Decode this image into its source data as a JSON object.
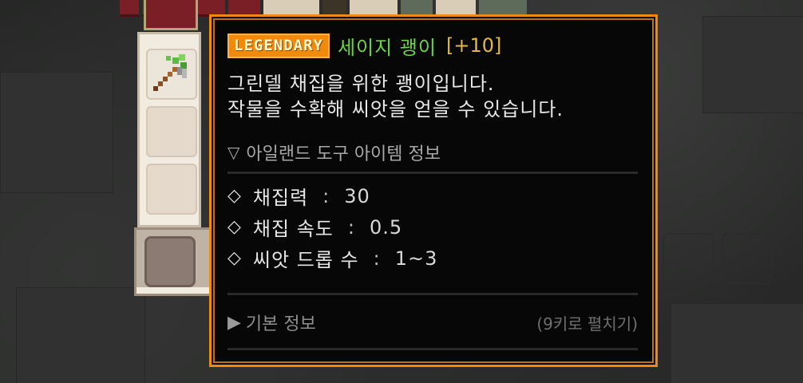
{
  "item": {
    "rarity": "LEGENDARY",
    "name": "세이지 괭이",
    "level": "[+10]",
    "description_lines": [
      "그린델 채집을 위한 괭이입니다.",
      "작물을 수확해 씨앗을 얻을 수 있습니다."
    ]
  },
  "tool_info": {
    "icon": "triangle-down-icon",
    "header": "아일랜드 도구 아이템 정보",
    "stats": [
      {
        "label": "채집력",
        "value": "30"
      },
      {
        "label": "채집 속도",
        "value": "0.5"
      },
      {
        "label": "씨앗 드롭 수",
        "value": "1~3"
      }
    ],
    "separator": ":"
  },
  "basic_info": {
    "icon": "triangle-right-icon",
    "label": "기본 정보",
    "hint": "(9키로 펼치기)"
  },
  "colors": {
    "rarity": "#f08a0c",
    "name": "#6bd44a",
    "level": "#e3b84a",
    "border": "#f08a0c"
  }
}
